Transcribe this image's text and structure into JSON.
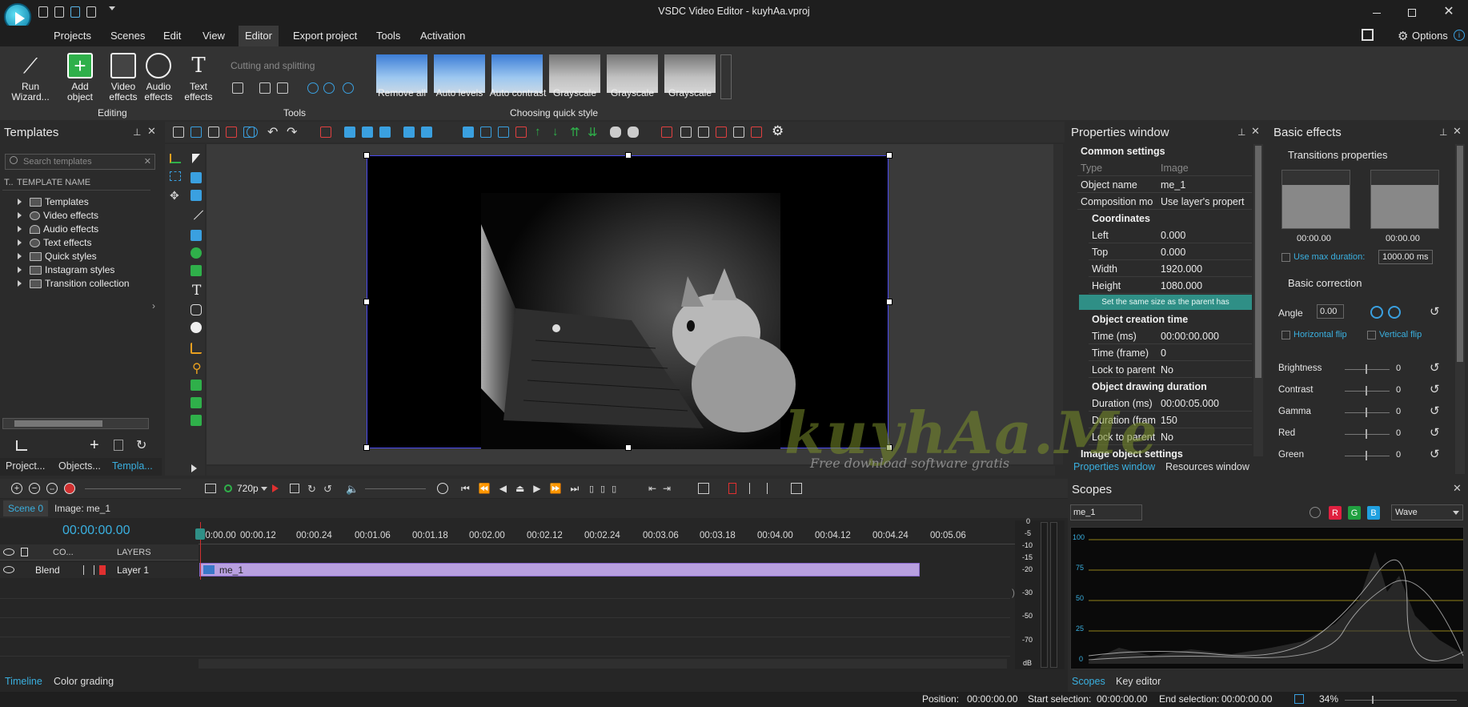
{
  "window": {
    "title": "VSDC Video Editor - kuyhAa.vproj",
    "options_label": "Options"
  },
  "menu": {
    "items": [
      "Projects",
      "Scenes",
      "Edit",
      "View",
      "Editor",
      "Export project",
      "Tools",
      "Activation"
    ],
    "active": "Editor"
  },
  "ribbon": {
    "run_wizard": "Run\nWizard...",
    "add_object": "Add\nobject",
    "video_effects": "Video\neffects",
    "audio_effects": "Audio\neffects",
    "text_effects": "Text\neffects",
    "editing_group": "Editing",
    "cutting": "Cutting and splitting",
    "tools_group": "Tools",
    "quick_style_group": "Choosing quick style",
    "quick_styles": [
      "Remove all",
      "Auto levels",
      "Auto contrast",
      "Grayscale",
      "Grayscale",
      "Grayscale"
    ]
  },
  "templates": {
    "title": "Templates",
    "search_placeholder": "Search templates",
    "column_t": "T..",
    "column_name": "TEMPLATE NAME",
    "items": [
      "Templates",
      "Video effects",
      "Audio effects",
      "Text effects",
      "Quick styles",
      "Instagram styles",
      "Transition collection"
    ],
    "tabs": [
      "Project...",
      "Objects...",
      "Templa..."
    ]
  },
  "properties": {
    "title": "Properties window",
    "common": "Common settings",
    "rows_top": [
      {
        "k": "Type",
        "v": "Image"
      },
      {
        "k": "Object name",
        "v": "me_1"
      },
      {
        "k": "Composition mo",
        "v": "Use layer's propert"
      }
    ],
    "coordinates": "Coordinates",
    "coord_rows": [
      {
        "k": "Left",
        "v": "0.000"
      },
      {
        "k": "Top",
        "v": "0.000"
      },
      {
        "k": "Width",
        "v": "1920.000"
      },
      {
        "k": "Height",
        "v": "1080.000"
      }
    ],
    "same_size_btn": "Set the same size as the parent has",
    "creation_time": "Object creation time",
    "creation_rows": [
      {
        "k": "Time (ms)",
        "v": "00:00:00.000"
      },
      {
        "k": "Time (frame)",
        "v": "0"
      },
      {
        "k": "Lock to parent",
        "v": "No"
      }
    ],
    "drawing_duration": "Object drawing duration",
    "duration_rows": [
      {
        "k": "Duration (ms)",
        "v": "00:00:05.000"
      },
      {
        "k": "Duration (fram",
        "v": "150"
      },
      {
        "k": "Lock to parent",
        "v": "No"
      }
    ],
    "image_settings": "Image object settings",
    "tab_props": "Properties window",
    "tab_resources": "Resources window"
  },
  "basic_effects": {
    "title": "Basic effects",
    "transitions": "Transitions properties",
    "time_left": "00:00.00",
    "time_right": "00:00.00",
    "use_max": "Use max duration:",
    "max_value": "1000.00 ms",
    "basic_correction": "Basic correction",
    "angle_label": "Angle",
    "angle_value": "0.00",
    "hflip": "Horizontal flip",
    "vflip": "Vertical flip",
    "adjust": [
      {
        "k": "Brightness",
        "v": "0"
      },
      {
        "k": "Contrast",
        "v": "0"
      },
      {
        "k": "Gamma",
        "v": "0"
      },
      {
        "k": "Red",
        "v": "0"
      },
      {
        "k": "Green",
        "v": "0"
      }
    ]
  },
  "timeline": {
    "resolution": "720p",
    "scene_tab": "Scene 0",
    "image_tab": "Image: me_1",
    "timecode": "00:00:00.00",
    "layers_hdr": "LAYERS",
    "co_hdr": "CO...",
    "blend": "Blend",
    "layer_name": "Layer 1",
    "clip_name": "me_1",
    "ruler": [
      "00:00.00",
      "00:00.12",
      "00:00.24",
      "00:01.06",
      "00:01.18",
      "00:02.00",
      "00:02.12",
      "00:02.24",
      "00:03.06",
      "00:03.18",
      "00:04.00",
      "00:04.12",
      "00:04.24",
      "00:05.06"
    ],
    "db_labels": [
      "0",
      "-5",
      "-10",
      "-15",
      "-20",
      "-30",
      "-50",
      "-70",
      "dB"
    ],
    "bottom_tabs": [
      "Timeline",
      "Color grading"
    ]
  },
  "scopes": {
    "title": "Scopes",
    "source": "me_1",
    "mode": "Wave",
    "channels": [
      "R",
      "G",
      "B"
    ],
    "levels": [
      "100",
      "75",
      "50",
      "25",
      "0"
    ],
    "tabs": [
      "Scopes",
      "Key editor"
    ]
  },
  "watermark": {
    "text": "kuyhAa.Me",
    "sub": "Free download software gratis"
  },
  "status": {
    "position_label": "Position:",
    "position": "00:00:00.00",
    "start_label": "Start selection:",
    "start": "00:00:00.00",
    "end_label": "End selection:",
    "end": "00:00:00.00",
    "zoom": "34%"
  }
}
